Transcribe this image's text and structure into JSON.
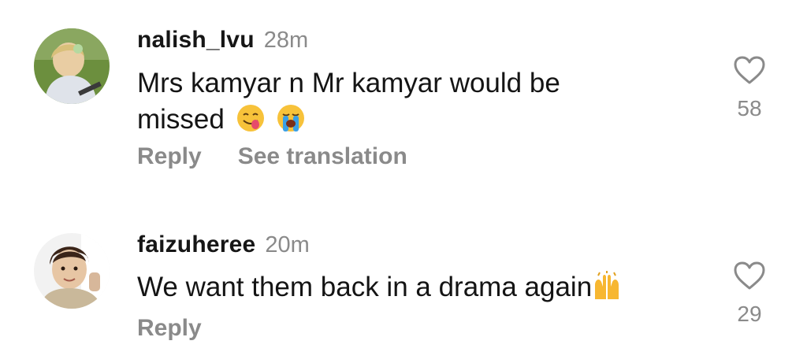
{
  "comments": [
    {
      "username": "nalish_lvu",
      "time": "28m",
      "text_line1": "Mrs kamyar n Mr kamyar would be",
      "text_line2": "missed",
      "emojis": [
        "face-savoring-food-icon",
        "loudly-crying-face-icon"
      ],
      "actions": [
        "Reply",
        "See translation"
      ],
      "likes": "58"
    },
    {
      "username": "faizuheree",
      "time": "20m",
      "text": "We want them back in a drama again",
      "emojis": [
        "raising-hands-icon"
      ],
      "actions": [
        "Reply"
      ],
      "likes": "29"
    }
  ],
  "colors": {
    "secondary_text": "#8a8a8a",
    "emoji_yellow": "#f7c23a",
    "tear_blue": "#3aa0e6"
  }
}
